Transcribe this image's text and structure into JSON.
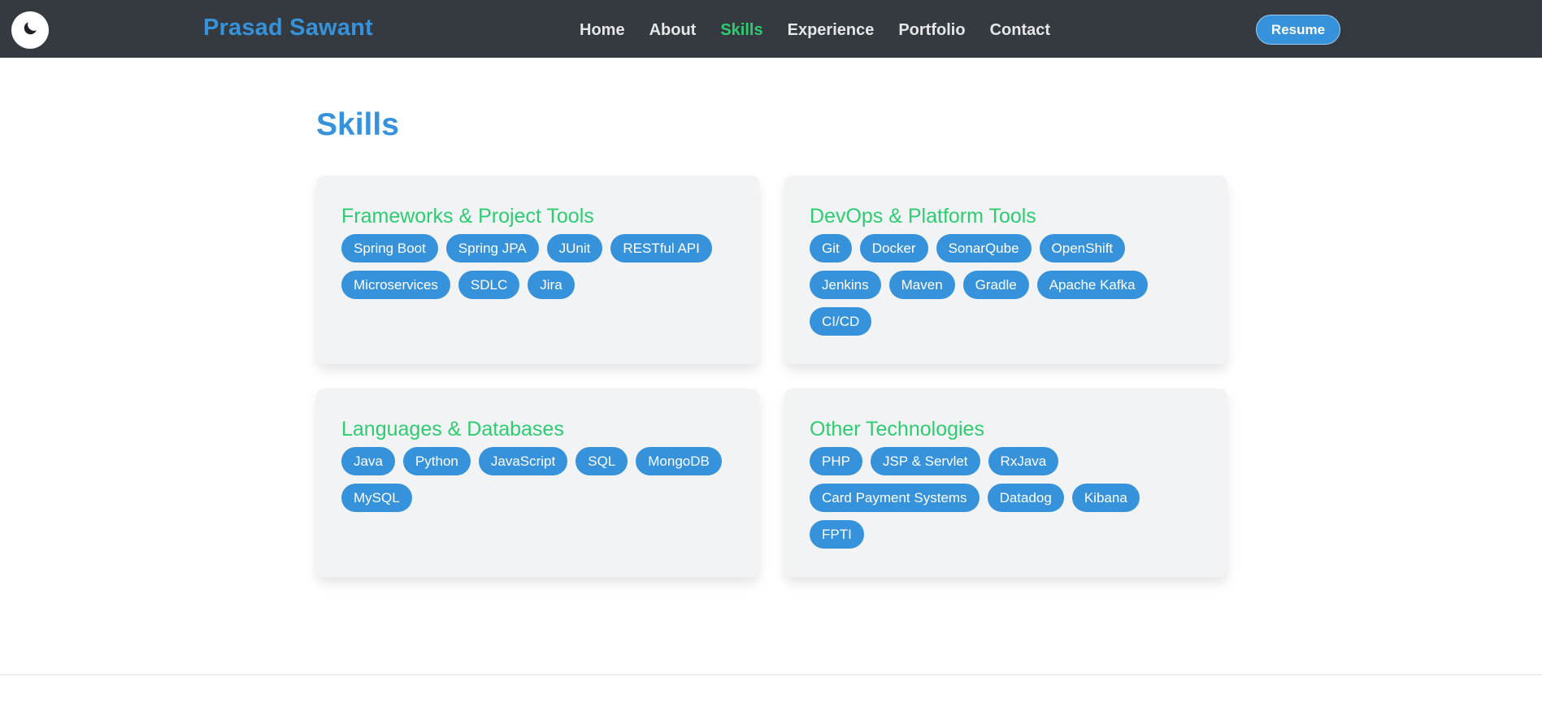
{
  "navbar": {
    "theme_toggle_icon": "moon-icon",
    "brand": "Prasad Sawant",
    "links": [
      "Home",
      "About",
      "Skills",
      "Experience",
      "Portfolio",
      "Contact"
    ],
    "active_link": "Skills",
    "resume_label": "Resume"
  },
  "skills": {
    "title": "Skills",
    "categories": [
      {
        "title": "Frameworks & Project Tools",
        "tags": [
          "Spring Boot",
          "Spring JPA",
          "JUnit",
          "RESTful API",
          "Microservices",
          "SDLC",
          "Jira"
        ]
      },
      {
        "title": "DevOps & Platform Tools",
        "tags": [
          "Git",
          "Docker",
          "SonarQube",
          "OpenShift",
          "Jenkins",
          "Maven",
          "Gradle",
          "Apache Kafka",
          "CI/CD"
        ]
      },
      {
        "title": "Languages & Databases",
        "tags": [
          "Java",
          "Python",
          "JavaScript",
          "SQL",
          "MongoDB",
          "MySQL"
        ]
      },
      {
        "title": "Other Technologies",
        "tags": [
          "PHP",
          "JSP & Servlet",
          "RxJava",
          "Card Payment Systems",
          "Datadog",
          "Kibana",
          "FPTI"
        ]
      }
    ]
  },
  "colors": {
    "navbar_bg": "#343a40",
    "brand_blue": "#3592db",
    "accent_green": "#2ecc71",
    "card_bg": "#f2f3f5"
  }
}
